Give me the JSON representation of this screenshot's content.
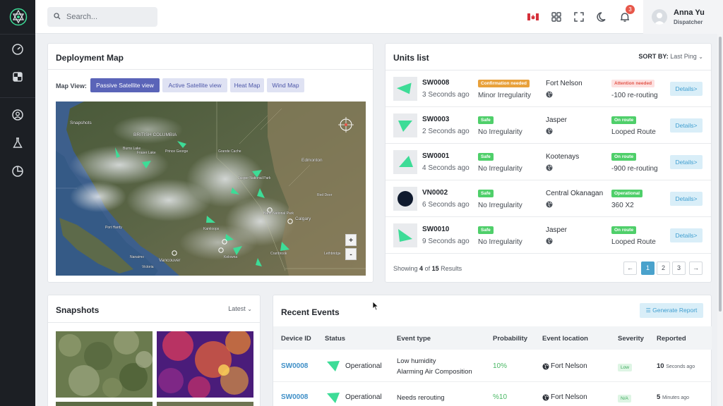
{
  "topbar": {
    "search_placeholder": "Search...",
    "notification_count": "3",
    "user": {
      "name": "Anna Yu",
      "role": "Dispatcher"
    }
  },
  "map_card": {
    "title": "Deployment Map",
    "map_view_label": "Map View:",
    "views": [
      "Passive Satellite view",
      "Active Satellite view",
      "Heat Map",
      "Wind Map"
    ],
    "active_view": "Passive Satellite view",
    "zoom_in": "+",
    "zoom_out": "-",
    "labels": {
      "british_columbia": "BRITISH COLUMBIA",
      "snapshots_place": "Snapshots",
      "burns_lake": "Burns Lake",
      "fraser_lake": "Fraser Lake",
      "prince_george": "Prince George",
      "edmonton": "Edmonton",
      "calgary": "Calgary",
      "kamloops": "Kamloops",
      "vancouver": "Vancouver",
      "kelowna": "Kelowna",
      "port_hardy": "Port Hardy",
      "jasper_np": "Jasper National Park",
      "banff_np": "Banff National Park",
      "grande_cache": "Grande Cache",
      "red_deer": "Red Deer",
      "lethbridge": "Lethbridge",
      "cranbrook": "Cranbrook",
      "nanaimo": "Nanaimo",
      "victoria": "Victoria"
    }
  },
  "units_card": {
    "title": "Units list",
    "sort_by_label": "SORT BY:",
    "sort_by_value": "Last Ping",
    "details_label": "Details>",
    "units": [
      {
        "id": "SW0008",
        "time": "3 Seconds ago",
        "badge": "Confirmation needed",
        "badge_color": "orange",
        "irregularity": "Minor Irregularity",
        "location": "Fort Nelson",
        "route_badge": "Attention needed",
        "route_badge_color": "red",
        "route": "-100 re-routing",
        "icon": "triangle-left"
      },
      {
        "id": "SW0003",
        "time": "2 Seconds ago",
        "badge": "Safe",
        "badge_color": "green",
        "irregularity": "No Irregularity",
        "location": "Jasper",
        "route_badge": "On route",
        "route_badge_color": "green",
        "route": "Looped Route",
        "icon": "triangle-down"
      },
      {
        "id": "SW0001",
        "time": "4 Seconds ago",
        "badge": "Safe",
        "badge_color": "green",
        "irregularity": "No Irregularity",
        "location": "Kootenays",
        "route_badge": "On route",
        "route_badge_color": "green",
        "route": "-900 re-routing",
        "icon": "triangle-up"
      },
      {
        "id": "VN0002",
        "time": "6 Seconds ago",
        "badge": "Safe",
        "badge_color": "green",
        "irregularity": "No Irregularity",
        "location": "Central Okanagan",
        "route_badge": "Operational",
        "route_badge_color": "green",
        "route": "360 X2",
        "icon": "circle"
      },
      {
        "id": "SW0010",
        "time": "9 Seconds ago",
        "badge": "Safe",
        "badge_color": "green",
        "irregularity": "No Irregularity",
        "location": "Jasper",
        "route_badge": "On route",
        "route_badge_color": "green",
        "route": "Looped Route",
        "icon": "triangle-right"
      }
    ],
    "showing_prefix": "Showing",
    "showing_count": "4",
    "showing_of": "of",
    "showing_total": "15",
    "showing_suffix": "Results",
    "pages": [
      "1",
      "2",
      "3"
    ],
    "prev": "←",
    "next": "→"
  },
  "snapshots_card": {
    "title": "Snapshots",
    "sort": "Latest"
  },
  "events_card": {
    "title": "Recent Events",
    "generate_label": "Generate Report",
    "columns": [
      "Device ID",
      "Status",
      "Event type",
      "Probability",
      "Event location",
      "Severity",
      "Reported"
    ],
    "rows": [
      {
        "device": "SW0008",
        "status": "Operational",
        "event_line1": "Low humidity",
        "event_line2": "Alarming Air Composition",
        "probability": "10%",
        "location": "Fort Nelson",
        "severity": "Low",
        "reported_num": "10",
        "reported_unit": "Seconds ago"
      },
      {
        "device": "SW0008",
        "status": "Operational",
        "event_line1": "Needs rerouting",
        "event_line2": "",
        "probability": "%10",
        "location": "Fort Nelson",
        "severity": "N/A",
        "reported_num": "5",
        "reported_unit": "Minutes ago"
      }
    ]
  },
  "colors": {
    "accent": "#5a64b8",
    "unit_marker": "#3ddc97",
    "safe": "#4fcf6a",
    "warning": "#e8a13b",
    "danger": "#e2564a",
    "link": "#3f8fc7"
  }
}
